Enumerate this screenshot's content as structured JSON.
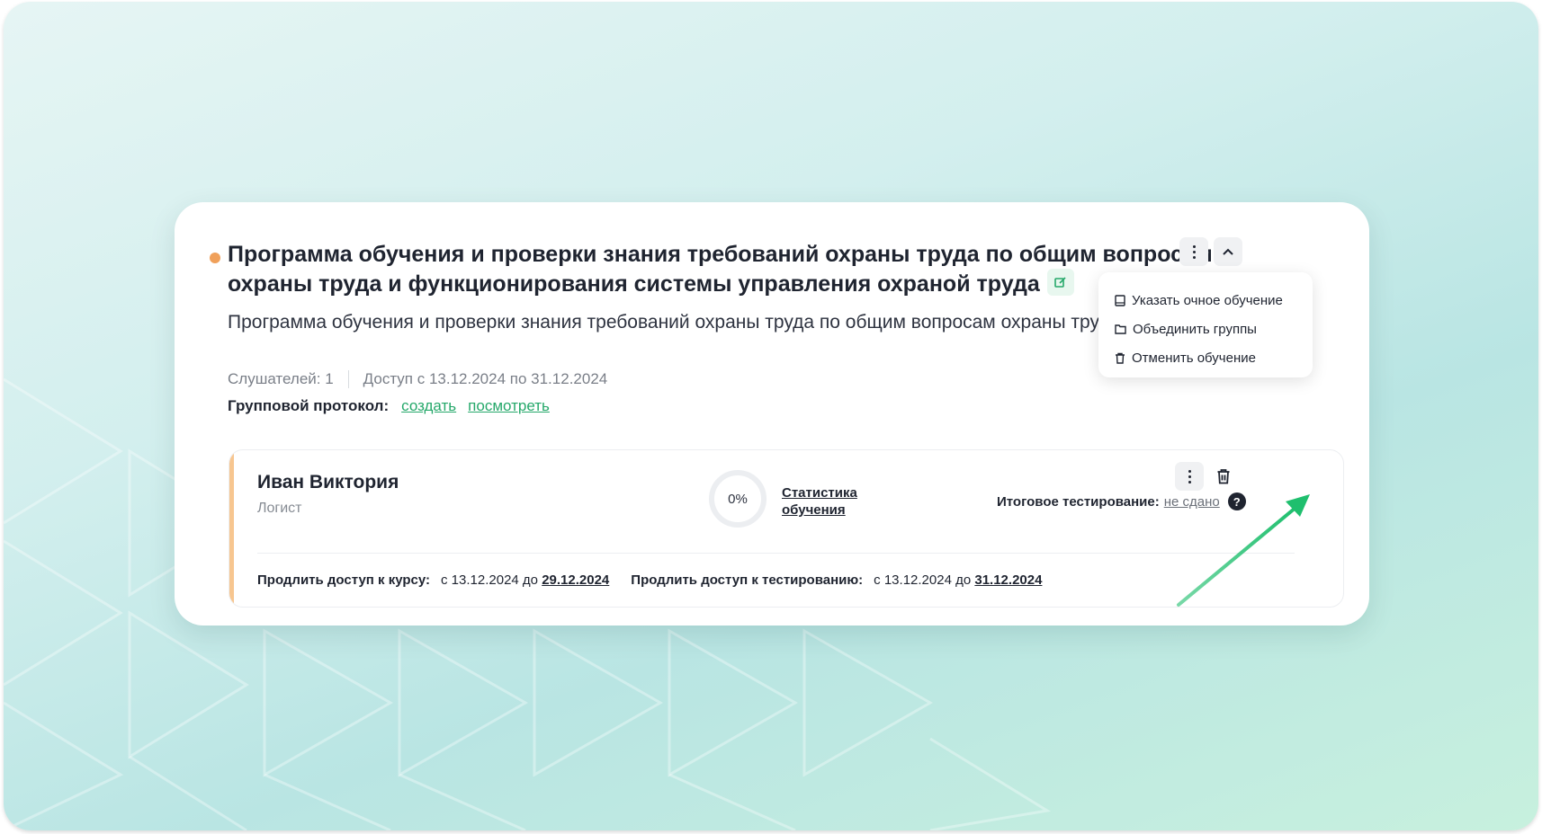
{
  "course": {
    "title": "Программа обучения и проверки знания требований охраны труда по общим вопросам охраны труда и функционирования системы управления охраной труда",
    "description": "Программа обучения и проверки знания требований охраны труда по общим вопросам охраны труда и функционирования системы управления охраной труда",
    "listeners": "Слушателей: 1",
    "access": "Доступ с 13.12.2024 по 31.12.2024",
    "protocol_label": "Групповой протокол:",
    "protocol_create": "создать",
    "protocol_view": "посмотреть"
  },
  "menu": {
    "items": [
      {
        "label": "Указать очное обучение",
        "icon": "book-icon"
      },
      {
        "label": "Объединить группы",
        "icon": "folder-icon"
      },
      {
        "label": "Отменить обучение",
        "icon": "trash-icon"
      }
    ]
  },
  "student": {
    "name": "Иван Виктория",
    "role": "Логист",
    "progress": "0%",
    "progress_value": 0,
    "stats_link": "Статистика обучения",
    "final_label": "Итоговое тестирование:",
    "final_status": "не сдано",
    "help": "?",
    "course_access_label": "Продлить доступ к курсу:",
    "course_access_from": "с 13.12.2024 до",
    "course_access_to": "29.12.2024",
    "test_access_label": "Продлить доступ к тестированию:",
    "test_access_from": "с 13.12.2024 до",
    "test_access_to": "31.12.2024"
  },
  "colors": {
    "accent_green": "#25a86a",
    "status_dot": "#f0a05a",
    "row_accent": "#f7c690",
    "arrow": "#1fbf6e"
  }
}
